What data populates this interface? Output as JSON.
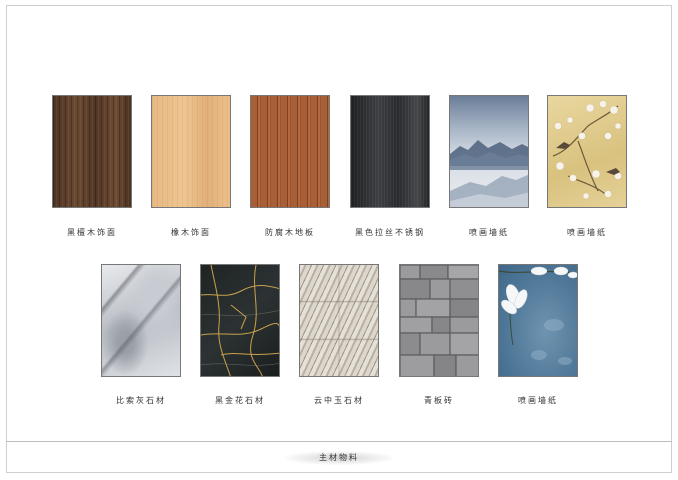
{
  "page": {
    "footer_title": "主材物料"
  },
  "materials_row1": [
    {
      "label": "黑檀木饰面",
      "texture": "ebony-wood"
    },
    {
      "label": "橡木饰面",
      "texture": "oak-wood"
    },
    {
      "label": "防腐木地板",
      "texture": "wood-decking"
    },
    {
      "label": "黑色拉丝不锈钢",
      "texture": "brushed-steel"
    },
    {
      "label": "喷画墙纸",
      "texture": "mountain-mural"
    },
    {
      "label": "喷画墙纸",
      "texture": "bird-blossom-mural"
    }
  ],
  "materials_row2": [
    {
      "label": "比索灰石材",
      "texture": "grey-marble"
    },
    {
      "label": "黑金花石材",
      "texture": "black-gold-marble"
    },
    {
      "label": "云中玉石材",
      "texture": "cloud-jade-stone"
    },
    {
      "label": "青板砖",
      "texture": "bluestone-brick"
    },
    {
      "label": "喷画墙纸",
      "texture": "magnolia-mural"
    }
  ]
}
